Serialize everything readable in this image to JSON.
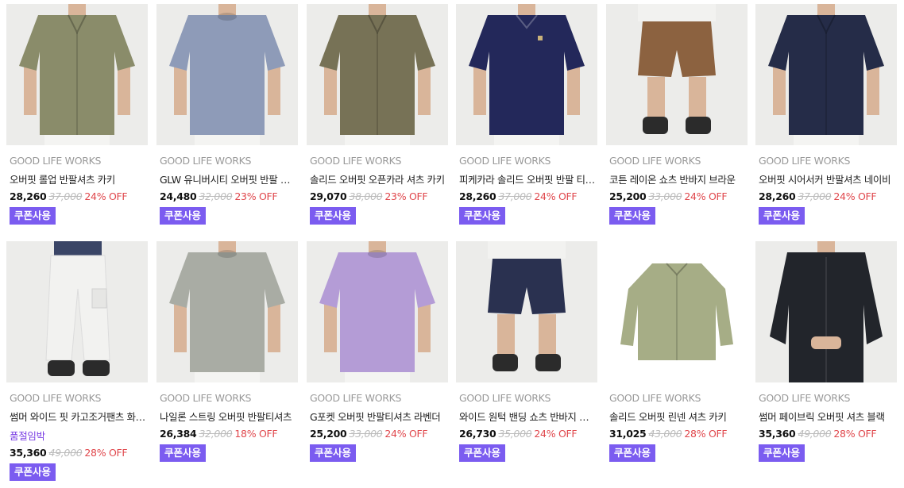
{
  "colors": {
    "coupon_bg": "#7b5cf0",
    "discount": "#e0474c",
    "soldout": "#7b3fe4",
    "brand_text": "#999999"
  },
  "products": [
    {
      "brand": "GOOD LIFE WORKS",
      "title": "오버핏 롤업 반팔셔츠 카키",
      "price": "28,260",
      "original": "37,000",
      "discount": "24% OFF",
      "coupon": "쿠폰사용",
      "garment": "shirt",
      "color": "#8a8c6a"
    },
    {
      "brand": "GOOD LIFE WORKS",
      "title": "GLW 유니버시티 오버핏 반팔 티셔츠",
      "price": "24,480",
      "original": "32,000",
      "discount": "23% OFF",
      "coupon": "쿠폰사용",
      "garment": "tee",
      "color": "#8e9bb8"
    },
    {
      "brand": "GOOD LIFE WORKS",
      "title": "솔리드 오버핏 오픈카라 셔츠 카키",
      "price": "29,070",
      "original": "38,000",
      "discount": "23% OFF",
      "coupon": "쿠폰사용",
      "garment": "shirt",
      "color": "#777256"
    },
    {
      "brand": "GOOD LIFE WORKS",
      "title": "피케카라 솔리드 오버핏 반팔 티셔츠",
      "price": "28,260",
      "original": "37,000",
      "discount": "24% OFF",
      "coupon": "쿠폰사용",
      "garment": "polo",
      "color": "#23285a"
    },
    {
      "brand": "GOOD LIFE WORKS",
      "title": "코튼 레이온 쇼츠 반바지 브라운",
      "price": "25,200",
      "original": "33,000",
      "discount": "24% OFF",
      "coupon": "쿠폰사용",
      "garment": "shorts",
      "color": "#8c6240"
    },
    {
      "brand": "GOOD LIFE WORKS",
      "title": "오버핏 시어서커 반팔셔츠 네이비",
      "price": "28,260",
      "original": "37,000",
      "discount": "24% OFF",
      "coupon": "쿠폰사용",
      "garment": "shirt",
      "color": "#252c48"
    },
    {
      "brand": "GOOD LIFE WORKS",
      "title": "썸머 와이드 핏 카고조거팬츠 화이트",
      "soldout": "품절임박",
      "price": "35,360",
      "original": "49,000",
      "discount": "28% OFF",
      "coupon": "쿠폰사용",
      "garment": "pants",
      "color": "#f2f2f0"
    },
    {
      "brand": "GOOD LIFE WORKS",
      "title": "나일론 스트링 오버핏 반팔티셔츠",
      "price": "26,384",
      "original": "32,000",
      "discount": "18% OFF",
      "coupon": "쿠폰사용",
      "garment": "tee",
      "color": "#a9aca4"
    },
    {
      "brand": "GOOD LIFE WORKS",
      "title": "G포켓 오버핏 반팔티셔츠 라벤더",
      "price": "25,200",
      "original": "33,000",
      "discount": "24% OFF",
      "coupon": "쿠폰사용",
      "garment": "tee",
      "color": "#b49cd6"
    },
    {
      "brand": "GOOD LIFE WORKS",
      "title": "와이드 원턱 밴딩 쇼츠 반바지 네이비",
      "price": "26,730",
      "original": "35,000",
      "discount": "24% OFF",
      "coupon": "쿠폰사용",
      "garment": "shorts",
      "color": "#2a3150"
    },
    {
      "brand": "GOOD LIFE WORKS",
      "title": "솔리드 오버핏 린넨 셔츠 카키",
      "price": "31,025",
      "original": "43,000",
      "discount": "28% OFF",
      "coupon": "쿠폰사용",
      "garment": "flatshirt",
      "color": "#a6ad86"
    },
    {
      "brand": "GOOD LIFE WORKS",
      "title": "썸머 페이브릭 오버핏 셔츠 블랙",
      "price": "35,360",
      "original": "49,000",
      "discount": "28% OFF",
      "coupon": "쿠폰사용",
      "garment": "longshirt",
      "color": "#22252b"
    }
  ]
}
